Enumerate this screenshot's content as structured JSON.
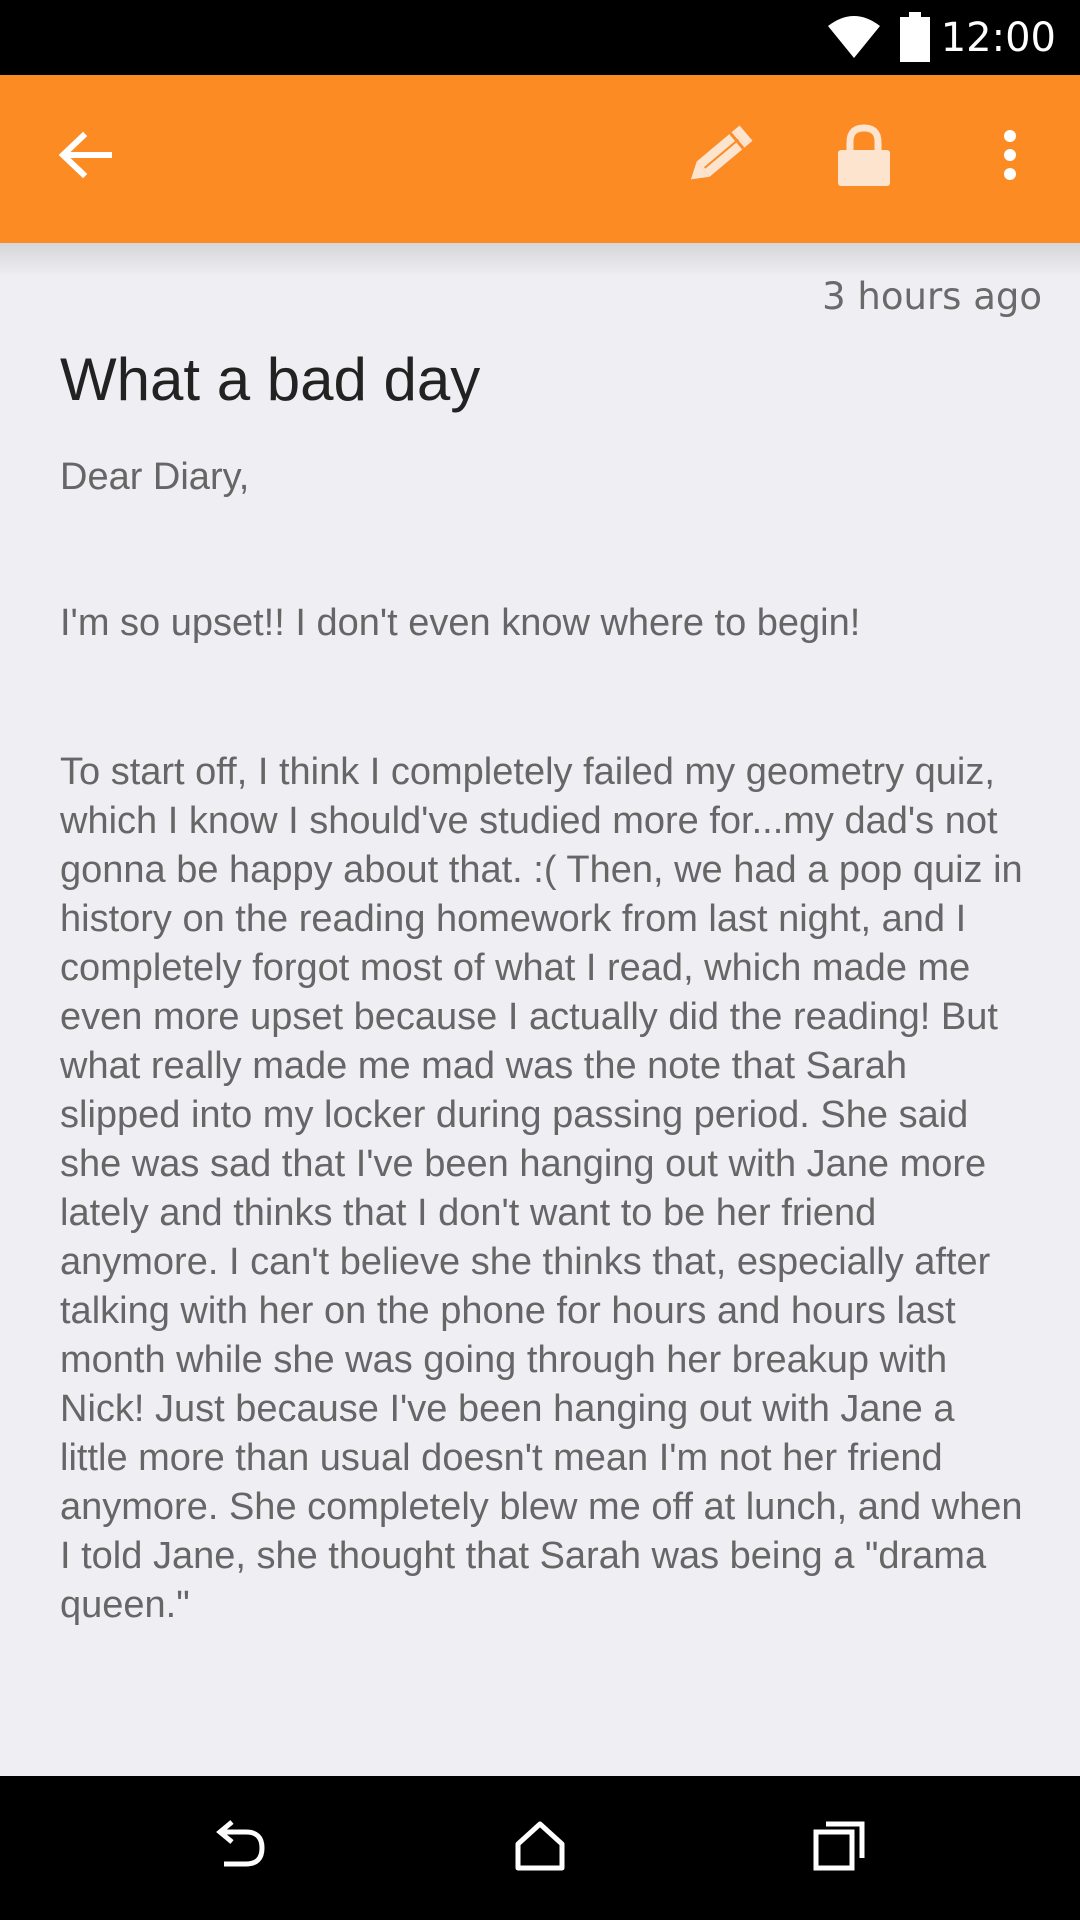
{
  "status_bar": {
    "time": "12:00",
    "icons": [
      "wifi-icon",
      "battery-icon"
    ]
  },
  "app_bar": {
    "color": "#fc8b24",
    "icons": [
      "back-arrow-icon",
      "pencil-icon",
      "lock-icon",
      "more-vert-icon"
    ]
  },
  "entry": {
    "timestamp": "3 hours ago",
    "title": "What a bad day",
    "greeting": "Dear Diary,",
    "paragraph_1": "I'm so upset!! I don't even know where to begin!",
    "paragraph_2": "To start off, I think I completely failed my geometry quiz, which I know I should've studied more for...my dad's not gonna be happy about that. :( Then, we had a pop quiz in history on the reading homework from last night, and I completely forgot most of what I read, which made me even more upset because I actually did the reading! But what really made me mad was the note that Sarah slipped into my locker during passing period. She said she was sad that I've been hanging out with Jane more lately and thinks that I don't want to be her friend anymore. I can't believe she thinks that, especially after talking with her on the phone for hours and hours last month while she was going through her breakup with Nick! Just because I've been hanging out with Jane a little more than usual doesn't mean I'm not her friend anymore. She completely blew me off at lunch, and when I told Jane, she thought that Sarah was being a \"drama queen.\""
  },
  "nav_bar": {
    "icons": [
      "nav-back-icon",
      "nav-home-icon",
      "nav-recents-icon"
    ]
  }
}
